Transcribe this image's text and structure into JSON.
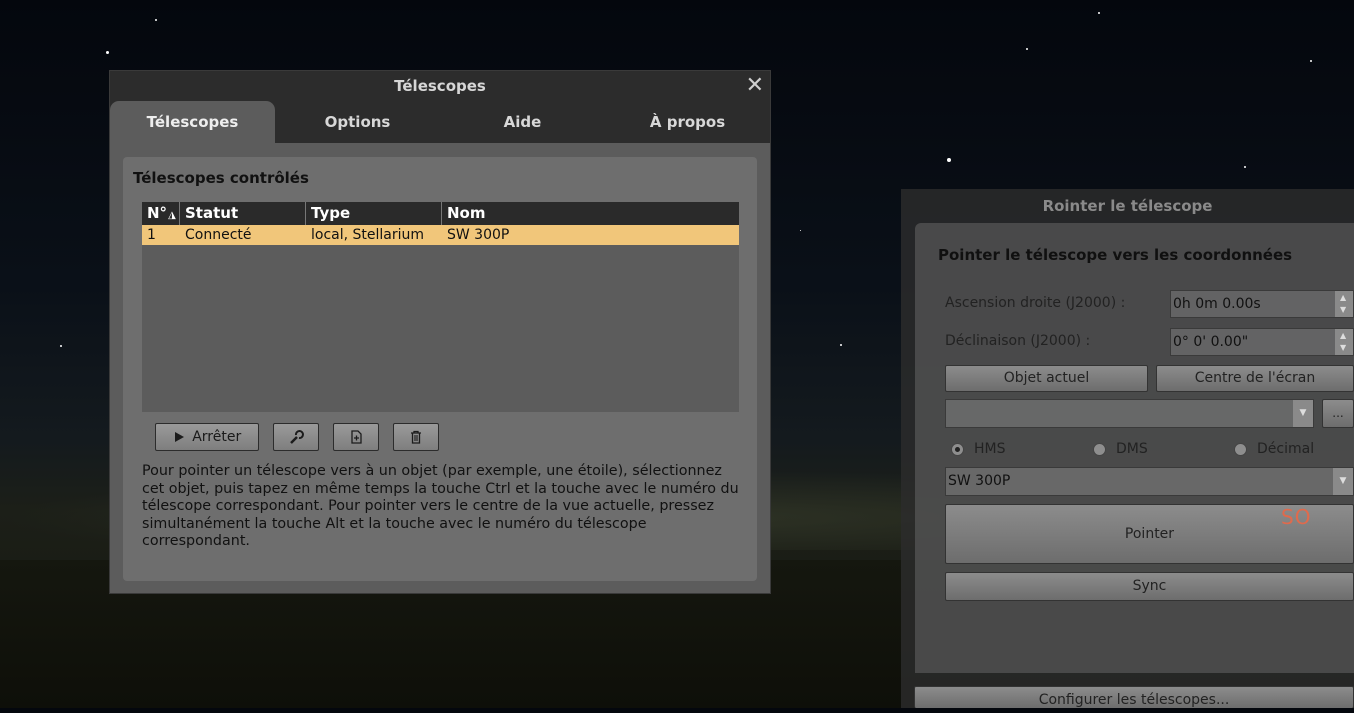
{
  "telescopes_window": {
    "title": "Télescopes",
    "close_glyph": "✕",
    "tabs": [
      {
        "label": "Télescopes",
        "active": true
      },
      {
        "label": "Options",
        "active": false
      },
      {
        "label": "Aide",
        "active": false
      },
      {
        "label": "À propos",
        "active": false
      }
    ],
    "section_title": "Télescopes contrôlés",
    "table": {
      "headers": [
        "N°",
        "Statut",
        "Type",
        "Nom"
      ],
      "rows": [
        {
          "number": "1",
          "status": "Connecté",
          "type": "local, Stellarium",
          "name": "SW 300P"
        }
      ]
    },
    "buttons": {
      "stop_label": "Arrêter",
      "configure_icon": "wrench-icon",
      "add_icon": "add-document-icon",
      "remove_icon": "trash-icon"
    },
    "help_text": "Pour pointer un télescope vers à un objet (par exemple, une étoile), sélectionnez cet objet, puis tapez en même temps la touche Ctrl et la touche avec le numéro du télescope correspondant. Pour pointer vers le centre de la vue actuelle, pressez simultanément la touche Alt et la touche avec le numéro du télescope correspondant."
  },
  "slew_window": {
    "title": "Rointer le télescope",
    "heading": "Pointer le télescope vers les coordonnées",
    "ra_label": "Ascension droite (J2000) :",
    "ra_value": "0h 0m 0.00s",
    "dec_label": "Déclinaison (J2000) :",
    "dec_value": "0° 0' 0.00\"",
    "current_object_button": "Objet actuel",
    "screen_center_button": "Centre de l'écran",
    "ellipsis_button": "...",
    "coord_format": [
      {
        "label": "HMS",
        "checked": true
      },
      {
        "label": "DMS",
        "checked": false
      },
      {
        "label": "Décimal",
        "checked": false
      }
    ],
    "telescope_select": "SW 300P",
    "point_button": "Pointer",
    "sync_button": "Sync",
    "configure_button": "Configurer les télescopes..."
  },
  "overlay": {
    "compass_label": "SO"
  },
  "colors": {
    "selected_row": "#f1c67a",
    "compass_label": "#e06a4c"
  }
}
